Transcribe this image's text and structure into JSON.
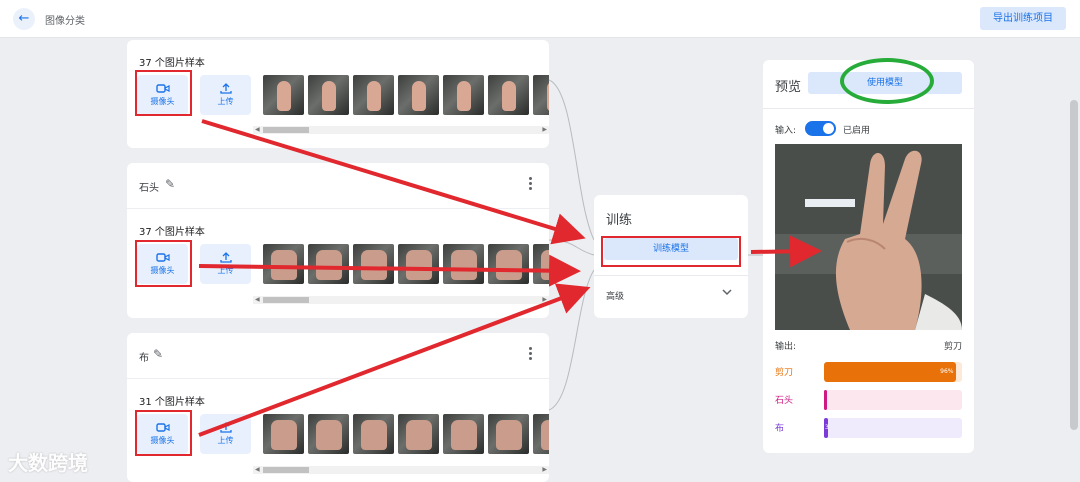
{
  "header": {
    "back_icon": "arrow-left-icon",
    "title": "图像分类",
    "export_label": "导出训练项目"
  },
  "classes": [
    {
      "name": "",
      "sample_count": "37 个图片样本",
      "webcam_label": "摄像头",
      "upload_label": "上传",
      "thumb_style": "peace"
    },
    {
      "name": "石头",
      "sample_count": "37 个图片样本",
      "webcam_label": "摄像头",
      "upload_label": "上传",
      "thumb_style": "fist"
    },
    {
      "name": "布",
      "sample_count": "31 个图片样本",
      "webcam_label": "摄像头",
      "upload_label": "上传",
      "thumb_style": "open"
    }
  ],
  "training": {
    "title": "训练",
    "train_button": "训练模型",
    "advanced_label": "高级"
  },
  "preview": {
    "title": "预览",
    "use_model_button": "使用模型",
    "input_label": "输入:",
    "toggle_on": true,
    "toggle_text": "已启用",
    "output_label": "输出:",
    "output_value": "剪刀",
    "results": [
      {
        "label": "剪刀",
        "percent": 96,
        "percent_text": "96%",
        "color": "#e8710a",
        "track": "#fde9d9"
      },
      {
        "label": "石头",
        "percent": 1,
        "percent_text": "",
        "color": "#d01884",
        "track": "#fde7ef"
      },
      {
        "label": "布",
        "percent": 3,
        "percent_text": "3",
        "color": "#7b3bd8",
        "track": "#efeafc"
      }
    ]
  },
  "watermark": "大数跨境",
  "colors": {
    "accent": "#1a73e8",
    "annotation_red": "#e0282e",
    "annotation_green": "#27ac3a"
  }
}
